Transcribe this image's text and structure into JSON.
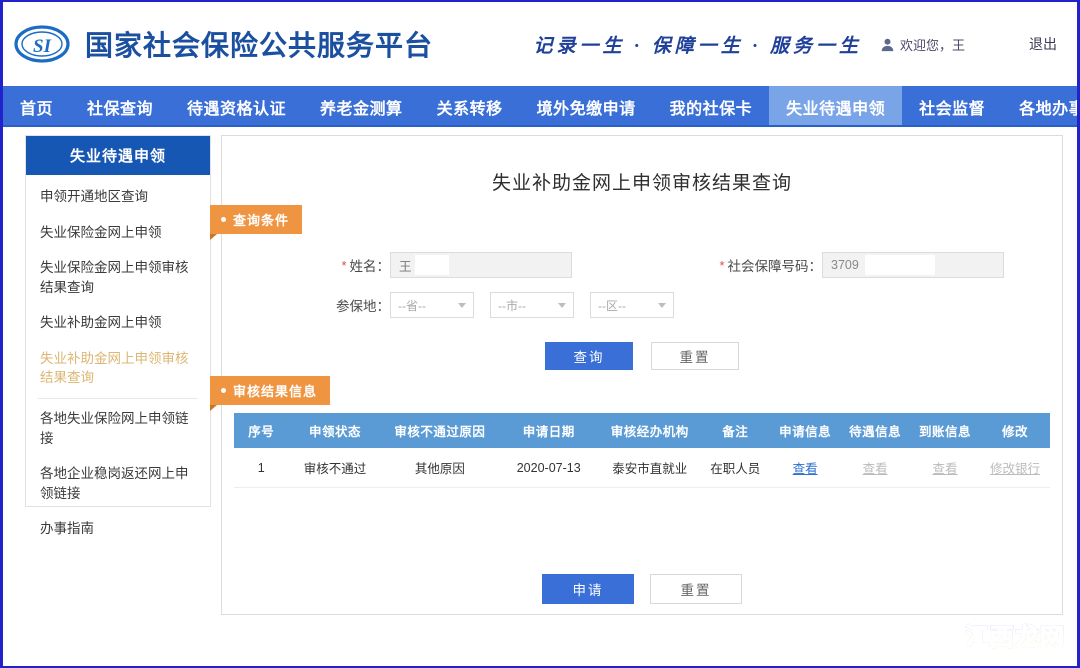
{
  "header": {
    "site_title": "国家社会保险公共服务平台",
    "logo_text": "SI",
    "slogan": "记录一生 · 保障一生 · 服务一生",
    "welcome_prefix": "欢迎您，王",
    "logout": "退出"
  },
  "nav": {
    "items": [
      {
        "label": "首页",
        "active": false
      },
      {
        "label": "社保查询",
        "active": false
      },
      {
        "label": "待遇资格认证",
        "active": false
      },
      {
        "label": "养老金测算",
        "active": false
      },
      {
        "label": "关系转移",
        "active": false
      },
      {
        "label": "境外免缴申请",
        "active": false
      },
      {
        "label": "我的社保卡",
        "active": false
      },
      {
        "label": "失业待遇申领",
        "active": true
      },
      {
        "label": "社会监督",
        "active": false
      },
      {
        "label": "各地办事э",
        "active": false
      }
    ]
  },
  "sidebar": {
    "title": "失业待遇申领",
    "items": [
      {
        "label": "申领开通地区查询",
        "active": false
      },
      {
        "label": "失业保险金网上申领",
        "active": false
      },
      {
        "label": "失业保险金网上申领审核结果查询",
        "active": false
      },
      {
        "label": "失业补助金网上申领",
        "active": false
      },
      {
        "label": "失业补助金网上申领审核结果查询",
        "active": true
      },
      {
        "label": "各地失业保险网上申领链接",
        "active": false
      },
      {
        "label": "各地企业稳岗返还网上申领链接",
        "active": false
      },
      {
        "label": "办事指南",
        "active": false
      }
    ]
  },
  "main": {
    "title": "失业补助金网上申领审核结果查询",
    "query_section_label": "查询条件",
    "result_section_label": "审核结果信息",
    "form": {
      "name_label": "姓名：",
      "name_value": "王",
      "sbn_label": "社会保障号码：",
      "sbn_value": "3709",
      "insured_place_label": "参保地：",
      "province_value": "--省--",
      "city_value": "--市--",
      "district_value": "--区--"
    },
    "buttons": {
      "query": "查询",
      "reset": "重置",
      "apply": "申请",
      "reset_bottom": "重置"
    },
    "table": {
      "headers": [
        "序号",
        "申领状态",
        "审核不通过原因",
        "申请日期",
        "审核经办机构",
        "备注",
        "申请信息",
        "待遇信息",
        "到账信息",
        "修改"
      ],
      "rows": [
        {
          "index": "1",
          "status": "审核不通过",
          "reason": "其他原因",
          "apply_date": "2020-07-13",
          "agency": "泰安市直就业",
          "remark": "在职人员",
          "apply_info": "查看",
          "benefit_info": "查看",
          "arrival_info": "查看",
          "modify": "修改银行"
        }
      ]
    }
  },
  "watermark": "江西龙网"
}
